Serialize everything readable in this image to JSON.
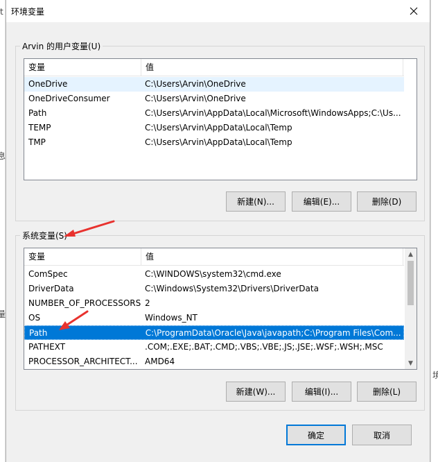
{
  "window": {
    "title": "环境变量"
  },
  "background": {
    "left_glyphs": [
      "t",
      "息",
      "量"
    ],
    "right_glyphs": [
      "境"
    ]
  },
  "user_vars": {
    "group_label": "Arvin 的用户变量(U)",
    "columns": [
      "变量",
      "值"
    ],
    "rows": [
      {
        "name": "OneDrive",
        "value": "C:\\Users\\Arvin\\OneDrive"
      },
      {
        "name": "OneDriveConsumer",
        "value": "C:\\Users\\Arvin\\OneDrive"
      },
      {
        "name": "Path",
        "value": "C:\\Users\\Arvin\\AppData\\Local\\Microsoft\\WindowsApps;C:\\Us..."
      },
      {
        "name": "TEMP",
        "value": "C:\\Users\\Arvin\\AppData\\Local\\Temp"
      },
      {
        "name": "TMP",
        "value": "C:\\Users\\Arvin\\AppData\\Local\\Temp"
      }
    ],
    "buttons": {
      "new": "新建(N)...",
      "edit": "编辑(E)...",
      "delete": "删除(D)"
    }
  },
  "system_vars": {
    "group_label": "系统变量(S)",
    "columns": [
      "变量",
      "值"
    ],
    "rows": [
      {
        "name": "ComSpec",
        "value": "C:\\WINDOWS\\system32\\cmd.exe"
      },
      {
        "name": "DriverData",
        "value": "C:\\Windows\\System32\\Drivers\\DriverData"
      },
      {
        "name": "NUMBER_OF_PROCESSORS",
        "value": "2"
      },
      {
        "name": "OS",
        "value": "Windows_NT"
      },
      {
        "name": "Path",
        "value": "C:\\ProgramData\\Oracle\\Java\\javapath;C:\\Program Files\\Com..."
      },
      {
        "name": "PATHEXT",
        "value": ".COM;.EXE;.BAT;.CMD;.VBS;.VBE;.JS;.JSE;.WSF;.WSH;.MSC"
      },
      {
        "name": "PROCESSOR_ARCHITECT...",
        "value": "AMD64"
      }
    ],
    "buttons": {
      "new": "新建(W)...",
      "edit": "编辑(I)...",
      "delete": "删除(L)"
    }
  },
  "footer": {
    "ok": "确定",
    "cancel": "取消"
  },
  "colors": {
    "selection": "#0078d7",
    "hover": "#e5f3ff",
    "annotation_arrow": "#e8322e"
  }
}
